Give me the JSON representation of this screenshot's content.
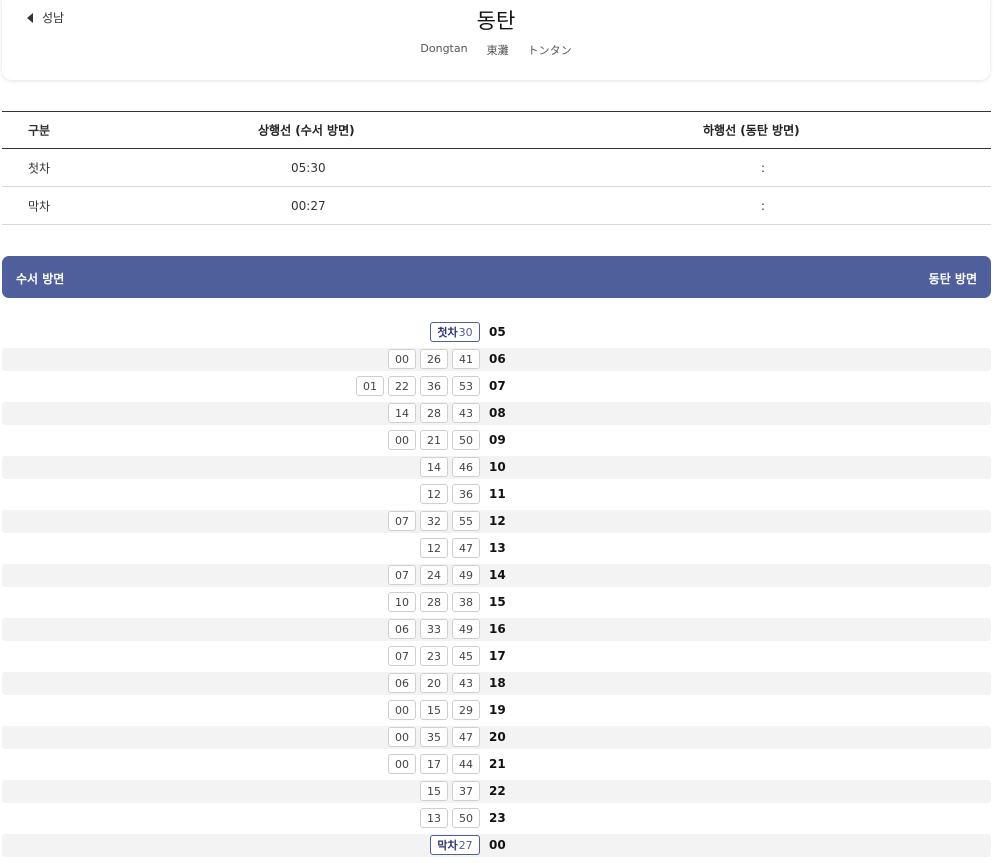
{
  "header": {
    "prev_station": "성남",
    "station_name": "동탄",
    "names": [
      "Dongtan",
      "東灘",
      "トンタン"
    ]
  },
  "first_last": {
    "headers": [
      "구분",
      "상행선 (수서 방면)",
      "하행선 (동탄 방면)"
    ],
    "rows": [
      {
        "label": "첫차",
        "up": "05:30",
        "down": ":"
      },
      {
        "label": "막차",
        "up": "00:27",
        "down": ":"
      }
    ]
  },
  "direction_bar": {
    "left": "수서 방면",
    "right": "동탄 방면",
    "color": "#4f5f9b"
  },
  "timetable": [
    {
      "hour": "05",
      "tag": "첫차",
      "tag_min": "30",
      "mins": []
    },
    {
      "hour": "06",
      "mins": [
        "00",
        "26",
        "41"
      ]
    },
    {
      "hour": "07",
      "mins": [
        "01",
        "22",
        "36",
        "53"
      ]
    },
    {
      "hour": "08",
      "mins": [
        "14",
        "28",
        "43"
      ]
    },
    {
      "hour": "09",
      "mins": [
        "00",
        "21",
        "50"
      ]
    },
    {
      "hour": "10",
      "mins": [
        "14",
        "46"
      ]
    },
    {
      "hour": "11",
      "mins": [
        "12",
        "36"
      ]
    },
    {
      "hour": "12",
      "mins": [
        "07",
        "32",
        "55"
      ]
    },
    {
      "hour": "13",
      "mins": [
        "12",
        "47"
      ]
    },
    {
      "hour": "14",
      "mins": [
        "07",
        "24",
        "49"
      ]
    },
    {
      "hour": "15",
      "mins": [
        "10",
        "28",
        "38"
      ]
    },
    {
      "hour": "16",
      "mins": [
        "06",
        "33",
        "49"
      ]
    },
    {
      "hour": "17",
      "mins": [
        "07",
        "23",
        "45"
      ]
    },
    {
      "hour": "18",
      "mins": [
        "06",
        "20",
        "43"
      ]
    },
    {
      "hour": "19",
      "mins": [
        "00",
        "15",
        "29"
      ]
    },
    {
      "hour": "20",
      "mins": [
        "00",
        "35",
        "47"
      ]
    },
    {
      "hour": "21",
      "mins": [
        "00",
        "17",
        "44"
      ]
    },
    {
      "hour": "22",
      "mins": [
        "15",
        "37"
      ]
    },
    {
      "hour": "23",
      "mins": [
        "13",
        "50"
      ]
    },
    {
      "hour": "00",
      "tag": "막차",
      "tag_min": "27",
      "mins": []
    }
  ]
}
